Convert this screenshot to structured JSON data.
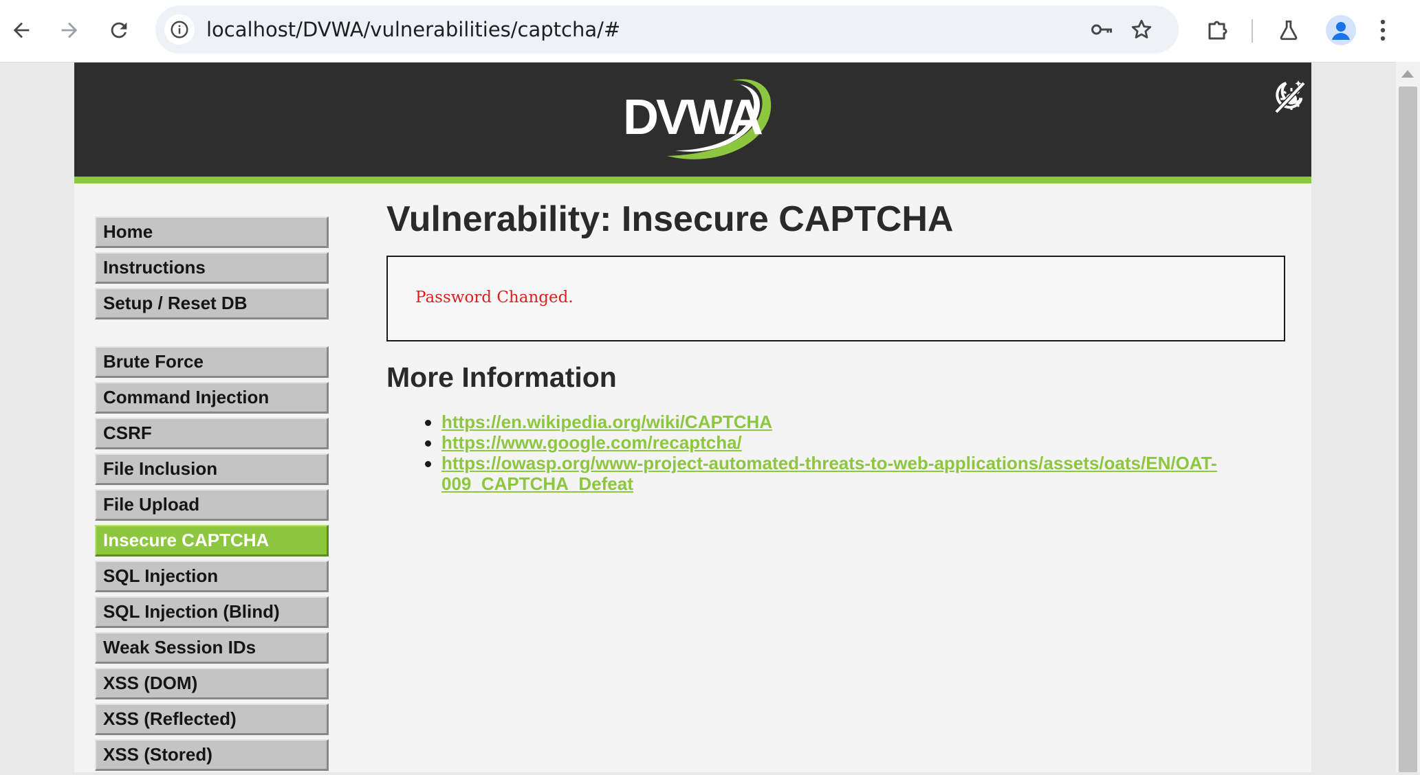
{
  "browser": {
    "url": "localhost/DVWA/vulnerabilities/captcha/#",
    "icons": {
      "back": "arrow-left-icon",
      "forward": "arrow-right-icon",
      "reload": "reload-icon",
      "site_info": "info-circle-icon",
      "password": "key-icon",
      "bookmark": "star-icon",
      "extensions": "puzzle-icon",
      "labs": "flask-icon",
      "profile": "person-icon",
      "menu": "three-dots-vertical-icon"
    },
    "colors": {
      "profile_bg": "#d3e3fd",
      "profile_fg": "#1a73e8"
    }
  },
  "header": {
    "logo_text": "DVWA",
    "theme_toggle_icon": "theme-toggle-icon",
    "colors": {
      "bg": "#2e2e2e",
      "accent": "#8dc63f"
    }
  },
  "menu": {
    "group1": [
      {
        "label": "Home"
      },
      {
        "label": "Instructions"
      },
      {
        "label": "Setup / Reset DB"
      }
    ],
    "group2": [
      {
        "label": "Brute Force"
      },
      {
        "label": "Command Injection"
      },
      {
        "label": "CSRF"
      },
      {
        "label": "File Inclusion"
      },
      {
        "label": "File Upload"
      },
      {
        "label": "Insecure CAPTCHA",
        "selected": true
      },
      {
        "label": "SQL Injection"
      },
      {
        "label": "SQL Injection (Blind)"
      },
      {
        "label": "Weak Session IDs"
      },
      {
        "label": "XSS (DOM)"
      },
      {
        "label": "XSS (Reflected)"
      },
      {
        "label": "XSS (Stored)"
      }
    ]
  },
  "main": {
    "title": "Vulnerability: Insecure CAPTCHA",
    "result_message": "Password Changed.",
    "more_info_title": "More Information",
    "links": [
      "https://en.wikipedia.org/wiki/CAPTCHA",
      "https://www.google.com/recaptcha/",
      "https://owasp.org/www-project-automated-threats-to-web-applications/assets/oats/EN/OAT-009_CAPTCHA_Defeat"
    ],
    "colors": {
      "link": "#8dc63f",
      "result_text": "#e11d1d"
    }
  }
}
